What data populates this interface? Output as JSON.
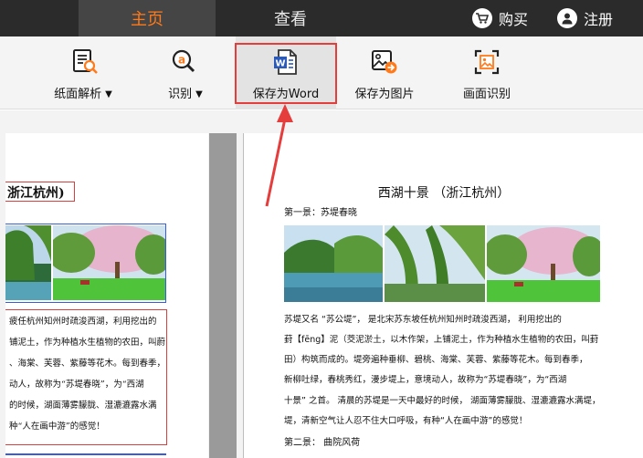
{
  "topbar": {
    "tabs": [
      {
        "label": "主页"
      },
      {
        "label": "查看"
      }
    ],
    "buy_label": "购买",
    "register_label": "注册"
  },
  "ribbon": {
    "buttons": [
      {
        "label": "纸面解析",
        "icon": "document-scan-icon"
      },
      {
        "label": "识别",
        "icon": "magnify-a-icon"
      },
      {
        "label": "保存为Word",
        "icon": "word-file-icon"
      },
      {
        "label": "保存为图片",
        "icon": "image-export-icon"
      },
      {
        "label": "画面识别",
        "icon": "screen-capture-icon"
      }
    ]
  },
  "left_page": {
    "title": "浙江杭州)",
    "lines": [
      "疲任杭州知州时疏浚西湖，利用挖出的",
      "铺泥土，作为种植水生植物的农田，叫蔚",
      "、海棠、芙蓉、紫藤等花木。每到春季，",
      "动人，故称为“苏堤春晓”，为“西湖",
      "的时候，湖面薄雾朦胧、湿漉漉露水满",
      "种“人在画中游”的感觉！"
    ]
  },
  "right_page": {
    "title": "西湖十景 （浙江杭州）",
    "subtitle": "第一景：苏堤春晓",
    "lines": [
      "苏堤又名 “苏公堤”， 是北宋苏东坡任杭州知州时疏浚西湖， 利用挖出的",
      "葑【fēng】泥（茭泥淤土，以木作架，上铺泥土，作为种植水生植物的农田，叫葑",
      "田）构筑而成的。堤旁遍种垂柳、碧桃、海棠、芙蓉、紫藤等花木。每到春季，",
      "新柳吐绿，春桃秀红，漫步堤上，意境动人，故称为“苏堤春晓”，为“西湖",
      "十景” 之首。 清晨的苏堤是一天中最好的时候， 湖面薄雾朦胧、湿漉漉露水满堤，",
      "堤，清新空气让人忍不住大口呼吸，有种“人在画中游”的感觉！"
    ],
    "footer": "第二景：  曲院风荷"
  },
  "colors": {
    "accent_orange": "#ff7a1a",
    "topbar_bg": "#2b2b2b",
    "highlight_red": "#e53c3c"
  }
}
